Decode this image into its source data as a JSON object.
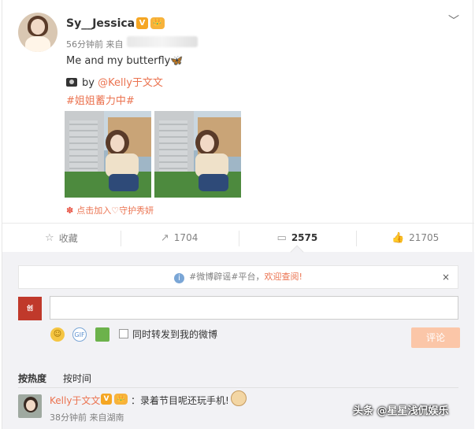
{
  "post": {
    "username": "Sy__Jessica",
    "verified_badge": "V",
    "member_badge": "👑",
    "time": "56分钟前 来自",
    "text_line1": "Me and my butterfly",
    "butterfly_emoji": "🦋",
    "by_prefix": "by",
    "mention": "@Kelly于文文",
    "topic": "#姐姐蓄力中#",
    "fanclub": "点击加入♡守护秀妍",
    "fanclub_icon": "✽",
    "photos": [
      "photo-1",
      "photo-2"
    ]
  },
  "actions": [
    {
      "label": "收藏",
      "icon": "☆",
      "name": "favorite"
    },
    {
      "label": "1704",
      "icon": "↗",
      "name": "repost"
    },
    {
      "label": "2575",
      "icon": "▭",
      "name": "comment"
    },
    {
      "label": "21705",
      "icon": "👍",
      "name": "like"
    }
  ],
  "notice": {
    "info_icon": "i",
    "text": "#微博辟谣#平台，",
    "link": "欢迎查阅!",
    "close": "×"
  },
  "composer": {
    "my_avatar_text": "创",
    "gif_label": "GIF",
    "repost_label": "同时转发到我的微博",
    "submit_label": "评论"
  },
  "sort": {
    "hot": "按热度",
    "time": "按时间"
  },
  "comment": {
    "name": "Kelly于文文",
    "verified_badge": "V",
    "member_badge": "👑",
    "text": "：录着节目呢还玩手机!",
    "meta": "38分钟前 来自湖南"
  },
  "watermark": "头条 @星星浅侃娱乐",
  "colors": {
    "accent": "#eb7350",
    "background_comments": "#f2f2f5",
    "badge_orange": "#f5a623"
  }
}
